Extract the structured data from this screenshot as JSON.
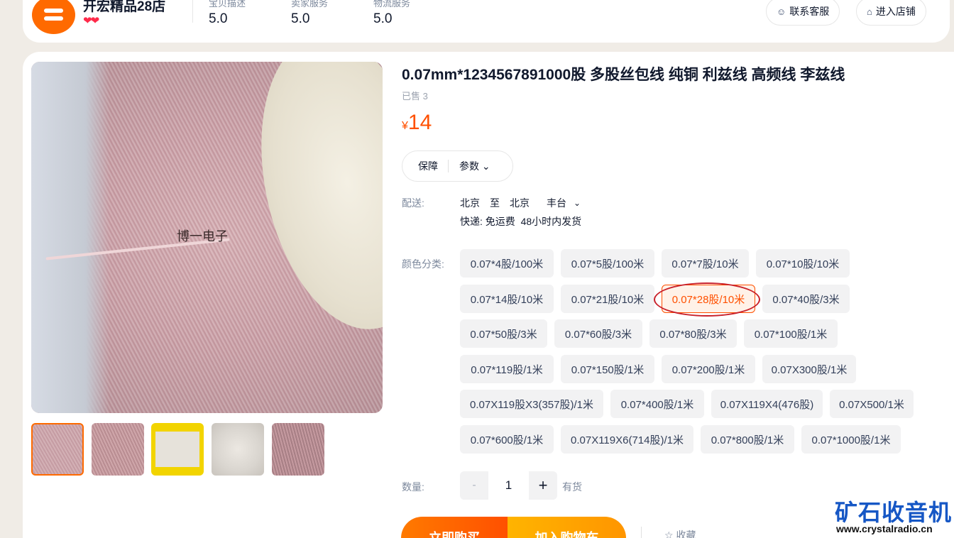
{
  "shop": {
    "name": "开宏精品28店",
    "hearts": "❤❤",
    "scores": [
      {
        "label": "宝贝描述",
        "value": "5.0"
      },
      {
        "label": "卖家服务",
        "value": "5.0"
      },
      {
        "label": "物流服务",
        "value": "5.0"
      }
    ],
    "contact_label": "联系客服",
    "store_label": "进入店铺"
  },
  "product": {
    "image_watermark": "博一电子",
    "title": "0.07mm*1234567891000股 多股丝包线 纯铜 利兹线 高频线 李兹线",
    "sold": "已售 3",
    "currency": "¥",
    "price": "14",
    "tabs": {
      "guarantee": "保障",
      "params": "参数"
    }
  },
  "delivery": {
    "label": "配送:",
    "from": "北京",
    "to_word": "至",
    "to_city": "北京",
    "district": "丰台",
    "express": "快递: 免运费",
    "ship_time": "48小时内发货"
  },
  "variants": {
    "label": "颜色分类:",
    "selected": "0.07*28股/10米",
    "options": [
      "0.07*4股/100米",
      "0.07*5股/100米",
      "0.07*7股/10米",
      "0.07*10股/10米",
      "0.07*14股/10米",
      "0.07*21股/10米",
      "0.07*28股/10米",
      "0.07*40股/3米",
      "0.07*50股/3米",
      "0.07*60股/3米",
      "0.07*80股/3米",
      "0.07*100股/1米",
      "0.07*119股/1米",
      "0.07*150股/1米",
      "0.07*200股/1米",
      "0.07X300股/1米",
      "0.07X119股X3(357股)/1米",
      "0.07*400股/1米",
      "0.07X119X4(476股)",
      "0.07X500/1米",
      "0.07*600股/1米",
      "0.07X119X6(714股)/1米",
      "0.07*800股/1米",
      "0.07*1000股/1米"
    ]
  },
  "quantity": {
    "label": "数量:",
    "minus": "-",
    "value": "1",
    "plus": "+",
    "stock": "有货"
  },
  "actions": {
    "buy": "立即购买",
    "cart": "加入购物车",
    "favorite": "收藏"
  },
  "watermark": {
    "brand": "矿石收音机",
    "url": "www.crystalradio.cn"
  },
  "colors": {
    "accent": "#ff5000",
    "annotation_circle": "#c8202a",
    "brand_blue": "#1657c5"
  },
  "icons": {
    "contact": "headset-icon",
    "store": "store-icon",
    "dropdown": "chevron-down-icon",
    "favorite": "star-icon"
  }
}
